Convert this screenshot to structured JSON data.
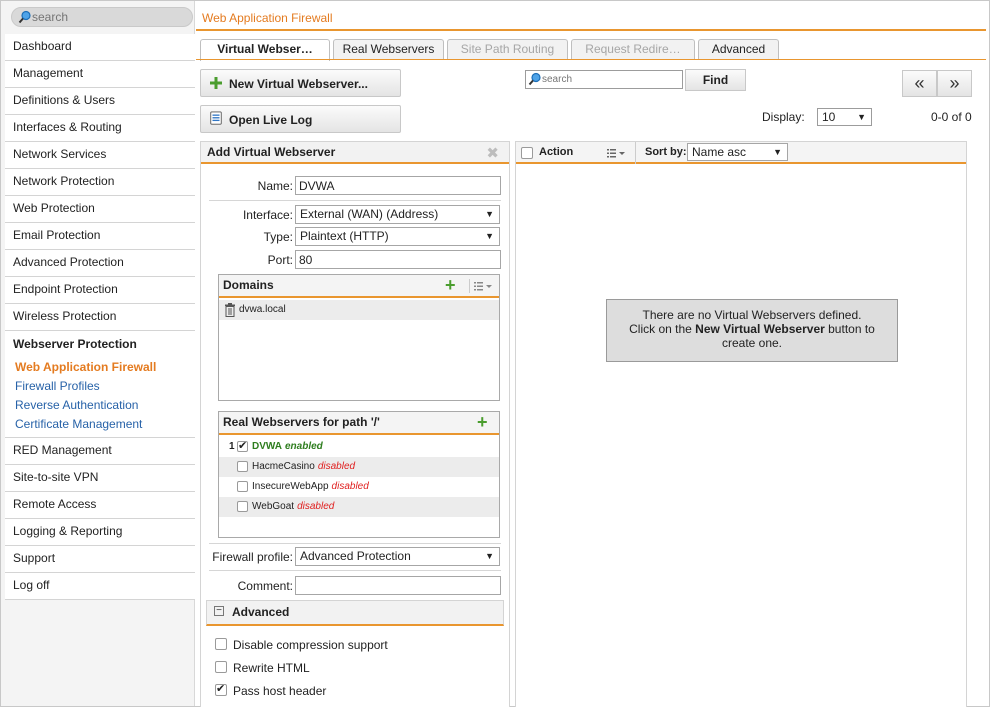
{
  "sidebar": {
    "search_placeholder": "search",
    "items_top": [
      {
        "label": "Dashboard"
      },
      {
        "label": "Management"
      },
      {
        "label": "Definitions & Users"
      },
      {
        "label": "Interfaces & Routing"
      },
      {
        "label": "Network Services"
      },
      {
        "label": "Network Protection"
      },
      {
        "label": "Web Protection"
      },
      {
        "label": "Email Protection"
      },
      {
        "label": "Advanced Protection"
      },
      {
        "label": "Endpoint Protection"
      },
      {
        "label": "Wireless Protection"
      }
    ],
    "group": {
      "title": "Webserver Protection",
      "subitems": [
        {
          "label": "Web Application Firewall",
          "active": true
        },
        {
          "label": "Firewall Profiles"
        },
        {
          "label": "Reverse Authentication"
        },
        {
          "label": "Certificate Management"
        }
      ]
    },
    "items_bottom": [
      {
        "label": "RED Management"
      },
      {
        "label": "Site-to-site VPN"
      },
      {
        "label": "Remote Access"
      },
      {
        "label": "Logging & Reporting"
      },
      {
        "label": "Support"
      },
      {
        "label": "Log off"
      }
    ]
  },
  "header": {
    "title": "Web Application Firewall"
  },
  "tabs": [
    {
      "label": "Virtual Webser…",
      "state": "active"
    },
    {
      "label": "Real Webservers",
      "state": "normal"
    },
    {
      "label": "Site Path Routing",
      "state": "disabled"
    },
    {
      "label": "Request Redire…",
      "state": "disabled"
    },
    {
      "label": "Advanced",
      "state": "normal"
    }
  ],
  "toolbar": {
    "new_button": "New Virtual Webserver...",
    "live_log_button": "Open Live Log",
    "search_placeholder": "search",
    "find_button": "Find",
    "prev_label": "«",
    "next_label": "»",
    "display_label": "Display:",
    "display_value": "10",
    "count": "0-0 of 0"
  },
  "form": {
    "title": "Add Virtual Webserver",
    "close_glyph": "✖",
    "name_label": "Name:",
    "name_value": "DVWA",
    "interface_label": "Interface:",
    "interface_value": "External (WAN) (Address)",
    "type_label": "Type:",
    "type_value": "Plaintext (HTTP)",
    "port_label": "Port:",
    "port_value": "80",
    "domains_title": "Domains",
    "domains": [
      {
        "name": "dvwa.local"
      }
    ],
    "real_title": "Real Webservers for path '/'",
    "real_servers": [
      {
        "index": "1",
        "name": "DVWA",
        "status": "enabled",
        "checked": true
      },
      {
        "index": "",
        "name": "HacmeCasino",
        "status": "disabled",
        "checked": false
      },
      {
        "index": "",
        "name": "InsecureWebApp",
        "status": "disabled",
        "checked": false
      },
      {
        "index": "",
        "name": "WebGoat",
        "status": "disabled",
        "checked": false
      }
    ],
    "firewall_profile_label": "Firewall profile:",
    "firewall_profile_value": "Advanced Protection",
    "comment_label": "Comment:",
    "comment_value": "",
    "advanced_title": "Advanced",
    "advanced_toggle": "−",
    "advanced_options": [
      {
        "label": "Disable compression support",
        "checked": false
      },
      {
        "label": "Rewrite HTML",
        "checked": false
      },
      {
        "label": "Pass host header",
        "checked": true
      }
    ]
  },
  "list": {
    "action_label": "Action",
    "sort_label": "Sort by:",
    "sort_value": "Name asc",
    "empty_line1": "There are no Virtual Webservers defined.",
    "empty_line2_pre": "Click on the ",
    "empty_line2_bold": "New Virtual Webserver",
    "empty_line2_post": " button to",
    "empty_line3": "create one."
  },
  "colors": {
    "accent": "#e47b20",
    "link": "#2762a8",
    "enabled": "#2e7d1e",
    "disabled": "#e02020",
    "add_green": "#4a9d2e"
  }
}
